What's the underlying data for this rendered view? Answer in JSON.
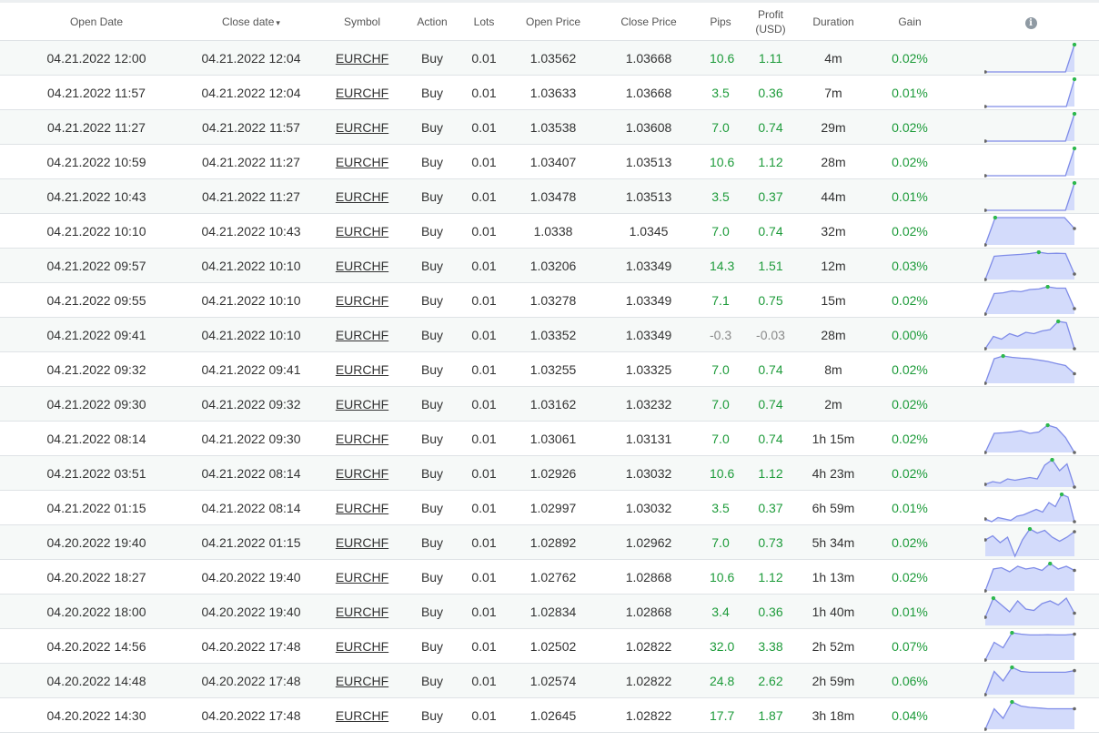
{
  "columns": {
    "open_date": "Open Date",
    "close_date": "Close date",
    "close_date_sort": "▾",
    "symbol": "Symbol",
    "action": "Action",
    "lots": "Lots",
    "open_price": "Open Price",
    "close_price": "Close Price",
    "pips": "Pips",
    "profit_line1": "Profit",
    "profit_line2": "(USD)",
    "duration": "Duration",
    "gain": "Gain",
    "info_icon": "i"
  },
  "colors": {
    "positive": "#1d9b3a",
    "neutral": "#8a8a8a",
    "spark_line": "#7f8ce8",
    "spark_fill": "#d3dbfb",
    "spark_marker_max": "#2db84d",
    "spark_marker_end": "#666666"
  },
  "rows": [
    {
      "open_date": "04.21.2022 12:00",
      "close_date": "04.21.2022 12:04",
      "symbol": "EURCHF",
      "action": "Buy",
      "lots": "0.01",
      "open_price": "1.03562",
      "close_price": "1.03668",
      "pips": "10.6",
      "profit": "1.11",
      "duration": "4m",
      "gain": "0.02%",
      "positive": true,
      "spark": [
        0.0,
        0.0,
        0.0,
        0.0,
        0.0,
        0.0,
        0.0,
        0.0,
        0.0,
        0.0,
        1.0
      ]
    },
    {
      "open_date": "04.21.2022 11:57",
      "close_date": "04.21.2022 12:04",
      "symbol": "EURCHF",
      "action": "Buy",
      "lots": "0.01",
      "open_price": "1.03633",
      "close_price": "1.03668",
      "pips": "3.5",
      "profit": "0.36",
      "duration": "7m",
      "gain": "0.01%",
      "positive": true,
      "spark": [
        0.0,
        0.0,
        0.0,
        0.0,
        0.0,
        0.0,
        0.0,
        0.0,
        0.0,
        0.0,
        0.0,
        1.0
      ]
    },
    {
      "open_date": "04.21.2022 11:27",
      "close_date": "04.21.2022 11:57",
      "symbol": "EURCHF",
      "action": "Buy",
      "lots": "0.01",
      "open_price": "1.03538",
      "close_price": "1.03608",
      "pips": "7.0",
      "profit": "0.74",
      "duration": "29m",
      "gain": "0.02%",
      "positive": true,
      "spark": [
        0.0,
        0.0,
        0.0,
        0.0,
        0.0,
        0.0,
        0.0,
        0.0,
        0.0,
        0.0,
        1.0
      ]
    },
    {
      "open_date": "04.21.2022 10:59",
      "close_date": "04.21.2022 11:27",
      "symbol": "EURCHF",
      "action": "Buy",
      "lots": "0.01",
      "open_price": "1.03407",
      "close_price": "1.03513",
      "pips": "10.6",
      "profit": "1.12",
      "duration": "28m",
      "gain": "0.02%",
      "positive": true,
      "spark": [
        0.0,
        0.0,
        0.0,
        0.0,
        0.0,
        0.0,
        0.0,
        0.0,
        0.0,
        0.0,
        1.0
      ]
    },
    {
      "open_date": "04.21.2022 10:43",
      "close_date": "04.21.2022 11:27",
      "symbol": "EURCHF",
      "action": "Buy",
      "lots": "0.01",
      "open_price": "1.03478",
      "close_price": "1.03513",
      "pips": "3.5",
      "profit": "0.37",
      "duration": "44m",
      "gain": "0.01%",
      "positive": true,
      "spark": [
        0.0,
        0.0,
        0.0,
        0.0,
        0.0,
        0.0,
        0.0,
        0.0,
        0.0,
        0.0,
        1.0
      ]
    },
    {
      "open_date": "04.21.2022 10:10",
      "close_date": "04.21.2022 10:43",
      "symbol": "EURCHF",
      "action": "Buy",
      "lots": "0.01",
      "open_price": "1.0338",
      "close_price": "1.0345",
      "pips": "7.0",
      "profit": "0.74",
      "duration": "32m",
      "gain": "0.02%",
      "positive": true,
      "spark": [
        0.0,
        1.0,
        1.0,
        1.0,
        1.0,
        1.0,
        1.0,
        1.0,
        1.0,
        0.6
      ]
    },
    {
      "open_date": "04.21.2022 09:57",
      "close_date": "04.21.2022 10:10",
      "symbol": "EURCHF",
      "action": "Buy",
      "lots": "0.01",
      "open_price": "1.03206",
      "close_price": "1.03349",
      "pips": "14.3",
      "profit": "1.51",
      "duration": "12m",
      "gain": "0.03%",
      "positive": true,
      "spark": [
        0.0,
        0.85,
        0.88,
        0.9,
        0.92,
        0.95,
        1.0,
        0.95,
        0.96,
        0.95,
        0.2
      ]
    },
    {
      "open_date": "04.21.2022 09:55",
      "close_date": "04.21.2022 10:10",
      "symbol": "EURCHF",
      "action": "Buy",
      "lots": "0.01",
      "open_price": "1.03278",
      "close_price": "1.03349",
      "pips": "7.1",
      "profit": "0.75",
      "duration": "15m",
      "gain": "0.02%",
      "positive": true,
      "spark": [
        0.0,
        0.75,
        0.78,
        0.85,
        0.82,
        0.9,
        0.92,
        1.0,
        0.95,
        0.95,
        0.2
      ]
    },
    {
      "open_date": "04.21.2022 09:41",
      "close_date": "04.21.2022 10:10",
      "symbol": "EURCHF",
      "action": "Buy",
      "lots": "0.01",
      "open_price": "1.03352",
      "close_price": "1.03349",
      "pips": "-0.3",
      "profit": "-0.03",
      "duration": "28m",
      "gain": "0.00%",
      "positive": false,
      "spark": [
        0.0,
        0.45,
        0.35,
        0.55,
        0.45,
        0.6,
        0.55,
        0.65,
        0.7,
        1.0,
        0.95,
        0.0
      ]
    },
    {
      "open_date": "04.21.2022 09:32",
      "close_date": "04.21.2022 09:41",
      "symbol": "EURCHF",
      "action": "Buy",
      "lots": "0.01",
      "open_price": "1.03255",
      "close_price": "1.03325",
      "pips": "7.0",
      "profit": "0.74",
      "duration": "8m",
      "gain": "0.02%",
      "positive": true,
      "spark": [
        0.0,
        0.9,
        1.0,
        0.95,
        0.92,
        0.9,
        0.85,
        0.8,
        0.72,
        0.65,
        0.35
      ]
    },
    {
      "open_date": "04.21.2022 09:30",
      "close_date": "04.21.2022 09:32",
      "symbol": "EURCHF",
      "action": "Buy",
      "lots": "0.01",
      "open_price": "1.03162",
      "close_price": "1.03232",
      "pips": "7.0",
      "profit": "0.74",
      "duration": "2m",
      "gain": "0.02%",
      "positive": true,
      "spark": null
    },
    {
      "open_date": "04.21.2022 08:14",
      "close_date": "04.21.2022 09:30",
      "symbol": "EURCHF",
      "action": "Buy",
      "lots": "0.01",
      "open_price": "1.03061",
      "close_price": "1.03131",
      "pips": "7.0",
      "profit": "0.74",
      "duration": "1h 15m",
      "gain": "0.02%",
      "positive": true,
      "spark": [
        0.0,
        0.7,
        0.72,
        0.75,
        0.8,
        0.7,
        0.75,
        1.0,
        0.9,
        0.55,
        0.0
      ]
    },
    {
      "open_date": "04.21.2022 03:51",
      "close_date": "04.21.2022 08:14",
      "symbol": "EURCHF",
      "action": "Buy",
      "lots": "0.01",
      "open_price": "1.02926",
      "close_price": "1.03032",
      "pips": "10.6",
      "profit": "1.12",
      "duration": "4h 23m",
      "gain": "0.02%",
      "positive": true,
      "spark": [
        0.1,
        0.2,
        0.15,
        0.3,
        0.25,
        0.3,
        0.35,
        0.3,
        0.8,
        1.0,
        0.6,
        0.85,
        0.0
      ]
    },
    {
      "open_date": "04.21.2022 01:15",
      "close_date": "04.21.2022 08:14",
      "symbol": "EURCHF",
      "action": "Buy",
      "lots": "0.01",
      "open_price": "1.02997",
      "close_price": "1.03032",
      "pips": "3.5",
      "profit": "0.37",
      "duration": "6h 59m",
      "gain": "0.01%",
      "positive": true,
      "spark": [
        0.1,
        0.0,
        0.15,
        0.1,
        0.05,
        0.2,
        0.25,
        0.35,
        0.45,
        0.35,
        0.7,
        0.55,
        1.0,
        0.9,
        0.0
      ]
    },
    {
      "open_date": "04.20.2022 19:40",
      "close_date": "04.21.2022 01:15",
      "symbol": "EURCHF",
      "action": "Buy",
      "lots": "0.01",
      "open_price": "1.02892",
      "close_price": "1.02962",
      "pips": "7.0",
      "profit": "0.73",
      "duration": "5h 34m",
      "gain": "0.02%",
      "positive": true,
      "spark": [
        0.6,
        0.75,
        0.5,
        0.7,
        0.0,
        0.6,
        1.0,
        0.85,
        0.95,
        0.7,
        0.55,
        0.7,
        0.9
      ]
    },
    {
      "open_date": "04.20.2022 18:27",
      "close_date": "04.20.2022 19:40",
      "symbol": "EURCHF",
      "action": "Buy",
      "lots": "0.01",
      "open_price": "1.02762",
      "close_price": "1.02868",
      "pips": "10.6",
      "profit": "1.12",
      "duration": "1h 13m",
      "gain": "0.02%",
      "positive": true,
      "spark": [
        0.0,
        0.8,
        0.85,
        0.7,
        0.9,
        0.8,
        0.85,
        0.75,
        1.0,
        0.8,
        0.9,
        0.75
      ]
    },
    {
      "open_date": "04.20.2022 18:00",
      "close_date": "04.20.2022 19:40",
      "symbol": "EURCHF",
      "action": "Buy",
      "lots": "0.01",
      "open_price": "1.02834",
      "close_price": "1.02868",
      "pips": "3.4",
      "profit": "0.36",
      "duration": "1h 40m",
      "gain": "0.01%",
      "positive": true,
      "spark": [
        0.3,
        1.0,
        0.75,
        0.5,
        0.9,
        0.6,
        0.55,
        0.8,
        0.9,
        0.75,
        1.0,
        0.45
      ]
    },
    {
      "open_date": "04.20.2022 14:56",
      "close_date": "04.20.2022 17:48",
      "symbol": "EURCHF",
      "action": "Buy",
      "lots": "0.01",
      "open_price": "1.02502",
      "close_price": "1.02822",
      "pips": "32.0",
      "profit": "3.38",
      "duration": "2h 52m",
      "gain": "0.07%",
      "positive": true,
      "spark": [
        0.0,
        0.65,
        0.45,
        1.0,
        0.95,
        0.92,
        0.92,
        0.93,
        0.92,
        0.92,
        0.95
      ]
    },
    {
      "open_date": "04.20.2022 14:48",
      "close_date": "04.20.2022 17:48",
      "symbol": "EURCHF",
      "action": "Buy",
      "lots": "0.01",
      "open_price": "1.02574",
      "close_price": "1.02822",
      "pips": "24.8",
      "profit": "2.62",
      "duration": "2h 59m",
      "gain": "0.06%",
      "positive": true,
      "spark": [
        0.0,
        0.85,
        0.5,
        1.0,
        0.85,
        0.82,
        0.82,
        0.82,
        0.82,
        0.82,
        0.88
      ]
    },
    {
      "open_date": "04.20.2022 14:30",
      "close_date": "04.20.2022 17:48",
      "symbol": "EURCHF",
      "action": "Buy",
      "lots": "0.01",
      "open_price": "1.02645",
      "close_price": "1.02822",
      "pips": "17.7",
      "profit": "1.87",
      "duration": "3h 18m",
      "gain": "0.04%",
      "positive": true,
      "spark": [
        0.0,
        0.75,
        0.4,
        1.0,
        0.85,
        0.8,
        0.78,
        0.75,
        0.75,
        0.75,
        0.75
      ]
    }
  ]
}
